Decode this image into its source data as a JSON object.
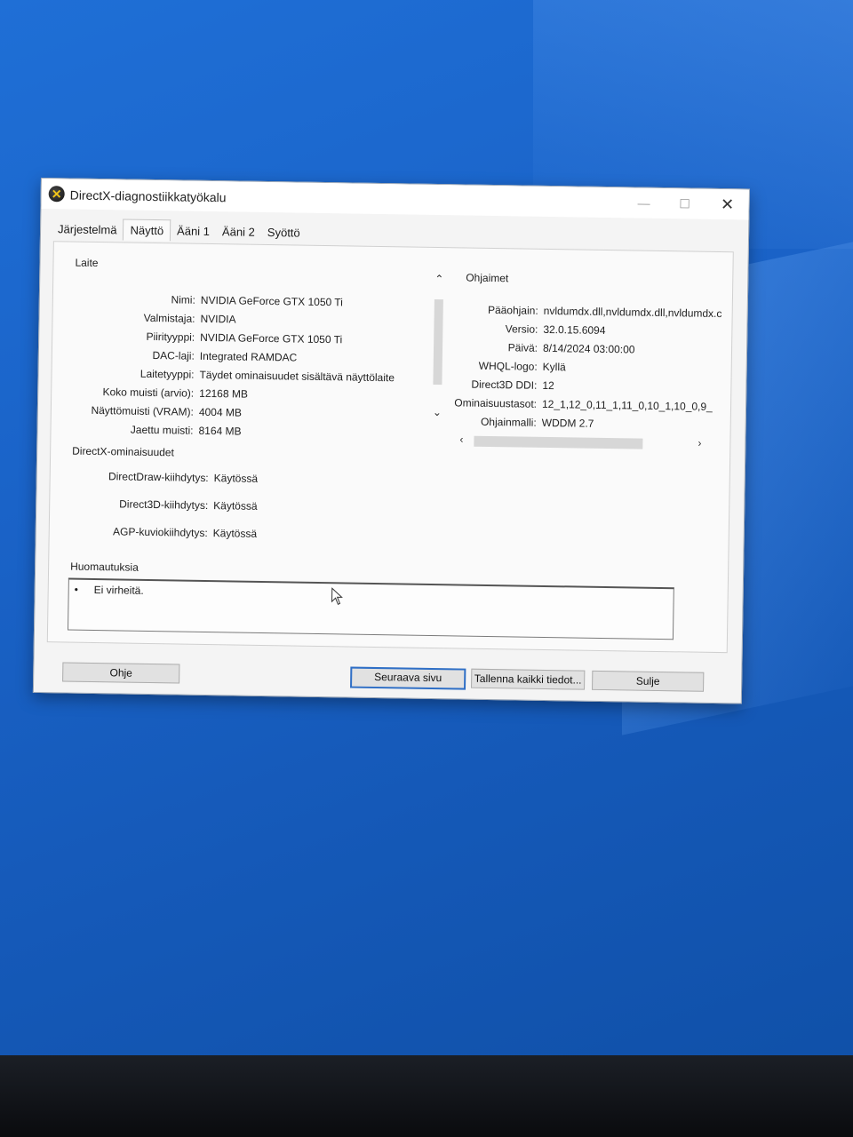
{
  "window": {
    "title": "DirectX-diagnostiikkatyökalu",
    "minimize_glyph": "—",
    "maximize_glyph": "☐",
    "close_glyph": "✕"
  },
  "tabs": [
    "Järjestelmä",
    "Näyttö",
    "Ääni 1",
    "Ääni 2",
    "Syöttö"
  ],
  "active_tab": "Näyttö",
  "device": {
    "section_label": "Laite",
    "rows": [
      {
        "label": "Nimi:",
        "value": "NVIDIA GeForce GTX 1050 Ti"
      },
      {
        "label": "Valmistaja:",
        "value": "NVIDIA"
      },
      {
        "label": "Piirityyppi:",
        "value": "NVIDIA GeForce GTX 1050 Ti"
      },
      {
        "label": "DAC-laji:",
        "value": "Integrated RAMDAC"
      },
      {
        "label": "Laitetyyppi:",
        "value": "Täydet ominaisuudet sisältävä näyttölaite"
      },
      {
        "label": "Koko muisti (arvio):",
        "value": "12168 MB"
      },
      {
        "label": "Näyttömuisti (VRAM):",
        "value": "4004 MB"
      },
      {
        "label": "Jaettu muisti:",
        "value": "8164 MB"
      }
    ]
  },
  "drivers": {
    "section_label": "Ohjaimet",
    "rows": [
      {
        "label": "Pääohjain:",
        "value": "nvldumdx.dll,nvldumdx.dll,nvldumdx.c"
      },
      {
        "label": "Versio:",
        "value": "32.0.15.6094"
      },
      {
        "label": "Päivä:",
        "value": "8/14/2024 03:00:00"
      },
      {
        "label": "WHQL-logo:",
        "value": "Kyllä"
      },
      {
        "label": "Direct3D DDI:",
        "value": "12"
      },
      {
        "label": "Ominaisuustasot:",
        "value": "12_1,12_0,11_1,11_0,10_1,10_0,9_"
      },
      {
        "label": "Ohjainmalli:",
        "value": "WDDM 2.7"
      }
    ]
  },
  "directx": {
    "section_label": "DirectX-ominaisuudet",
    "rows": [
      {
        "label": "DirectDraw-kiihdytys:",
        "value": "Käytössä"
      },
      {
        "label": "Direct3D-kiihdytys:",
        "value": "Käytössä"
      },
      {
        "label": "AGP-kuviokiihdytys:",
        "value": "Käytössä"
      }
    ]
  },
  "notes": {
    "section_label": "Huomautuksia",
    "items": [
      "Ei virheitä."
    ]
  },
  "buttons": {
    "help": "Ohje",
    "next_page": "Seuraava sivu",
    "save_all": "Tallenna kaikki tiedot...",
    "close": "Sulje"
  },
  "scroll_glyphs": {
    "up": "⌃",
    "down": "⌄",
    "left": "‹",
    "right": "›"
  }
}
